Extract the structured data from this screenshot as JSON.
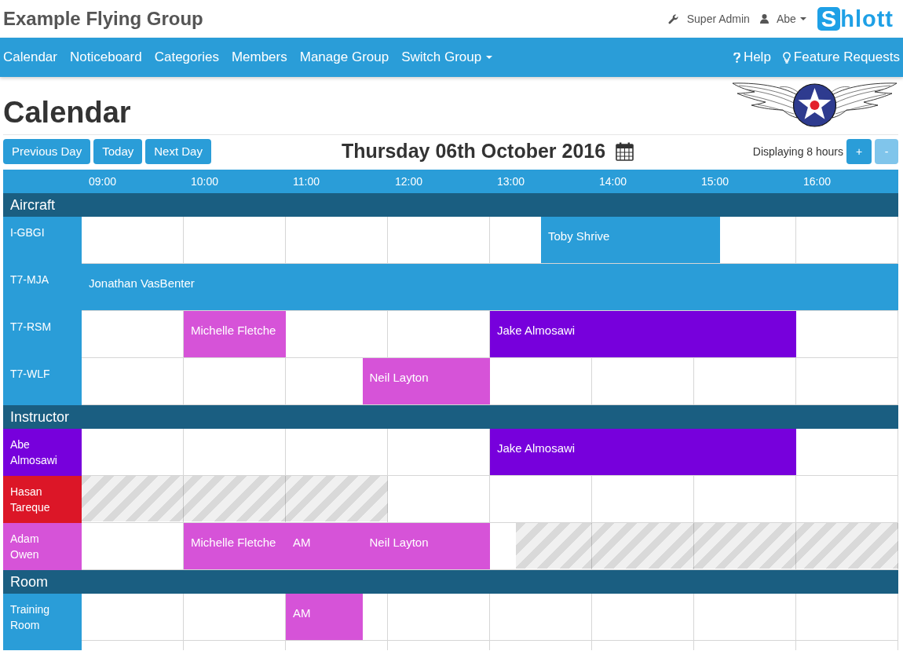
{
  "header": {
    "title": "Example Flying Group",
    "admin_link": "Super Admin",
    "user_menu": "Abe",
    "brand": {
      "initial": "S",
      "rest": "hlott"
    }
  },
  "nav": {
    "items": [
      {
        "label": "Calendar",
        "dropdown": false
      },
      {
        "label": "Noticeboard",
        "dropdown": false
      },
      {
        "label": "Categories",
        "dropdown": false
      },
      {
        "label": "Members",
        "dropdown": false
      },
      {
        "label": "Manage Group",
        "dropdown": false
      },
      {
        "label": "Switch Group",
        "dropdown": true
      }
    ],
    "right_items": [
      {
        "label": "Help",
        "kind": "help"
      },
      {
        "label": "Feature Requests",
        "kind": "idea"
      }
    ]
  },
  "page": {
    "title": "Calendar"
  },
  "toolbar": {
    "buttons": [
      {
        "label": "Previous Day"
      },
      {
        "label": "Today"
      },
      {
        "label": "Next Day"
      }
    ],
    "date": "Thursday 06th October 2016",
    "display_text": "Displaying 8 hours",
    "zoom_buttons": [
      {
        "label": "+",
        "disabled": false
      },
      {
        "label": "-",
        "disabled": true
      }
    ]
  },
  "timeline": {
    "hours": [
      "09:00",
      "10:00",
      "11:00",
      "12:00",
      "13:00",
      "14:00",
      "15:00",
      "16:00"
    ]
  },
  "sections": [
    {
      "title": "Aircraft",
      "resources": [
        {
          "name": "I-GBGI",
          "color": "#2a9dd8",
          "blocks": [
            {
              "kind": "booking",
              "label": "Toby Shrive",
              "color": "#2a9dd8"
            }
          ]
        },
        {
          "name": "T7-MJA",
          "color": "#2a9dd8",
          "blocks": [
            {
              "kind": "booking",
              "label": "Jonathan VasBenter",
              "color": "#2a9dd8"
            }
          ]
        },
        {
          "name": "T7-RSM",
          "color": "#2a9dd8",
          "blocks": [
            {
              "kind": "booking",
              "label": "Michelle Fletche",
              "color": "#d653d8"
            },
            {
              "kind": "booking",
              "label": "Jake Almosawi",
              "color": "#7700dc"
            }
          ]
        },
        {
          "name": "T7-WLF",
          "color": "#2a9dd8",
          "blocks": [
            {
              "kind": "booking",
              "label": "Neil Layton",
              "color": "#d653d8"
            }
          ]
        }
      ]
    },
    {
      "title": "Instructor",
      "resources": [
        {
          "name": "Abe Almosawi",
          "color": "#7700dc",
          "blocks": [
            {
              "kind": "booking",
              "label": "Jake Almosawi",
              "color": "#7700dc"
            }
          ]
        },
        {
          "name": "Hasan Tareque",
          "color": "#dc1627",
          "blocks": [
            {
              "kind": "unavailable"
            }
          ]
        },
        {
          "name": "Adam Owen",
          "color": "#d653d8",
          "blocks": [
            {
              "kind": "booking",
              "label": "Michelle Fletche",
              "color": "#d653d8"
            },
            {
              "kind": "booking",
              "label": "AM",
              "color": "#d653d8"
            },
            {
              "kind": "booking",
              "label": "Neil Layton",
              "color": "#d653d8"
            },
            {
              "kind": "unavailable"
            }
          ]
        }
      ]
    },
    {
      "title": "Room",
      "resources": [
        {
          "name": "Training Room",
          "color": "#2a9dd8",
          "blocks": [
            {
              "kind": "booking",
              "label": "AM",
              "color": "#d653d8"
            }
          ]
        }
      ]
    }
  ]
}
